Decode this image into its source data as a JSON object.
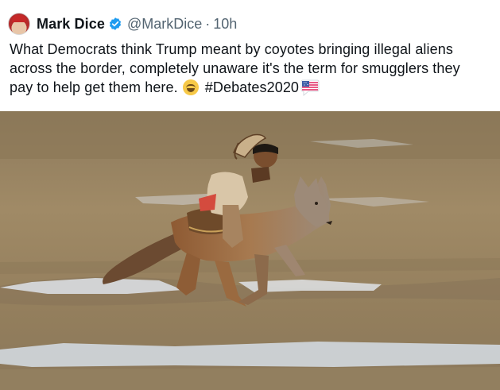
{
  "tweet": {
    "author_name": "Mark Dice",
    "handle": "@MarkDice",
    "separator": "·",
    "timestamp": "10h",
    "text": "What Democrats think Trump meant by coyotes bringing illegal aliens across the border, completely unaware it's the term for smugglers they pay to help get them here.",
    "hashtag": "#Debates2020"
  },
  "icons": {
    "verified": "verified-badge-icon",
    "laugh_emoji": "grinning-squinting-face-emoji",
    "flag_emoji": "us-flag-speech-bubble-emoji"
  },
  "colors": {
    "verified_blue": "#1d9bf0",
    "secondary_text": "#536471",
    "primary_text": "#0f1419"
  }
}
